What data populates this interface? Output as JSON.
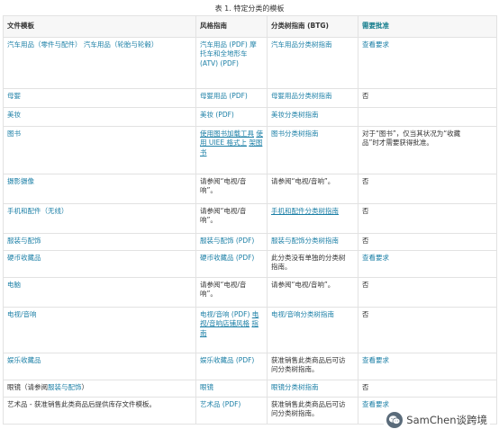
{
  "caption": "表 1. 特定分类的模板",
  "headers": [
    "文件模板",
    "风格指南",
    "分类树指南 (BTG)",
    "需要批准"
  ],
  "rows": [
    {
      "c1": [
        "汽车用品（零件与配件）",
        "汽车用品（轮胎与轮毂）"
      ],
      "c2": [
        "汽车用品 (PDF)",
        "摩托车和全地形车",
        "(ATV) (PDF)"
      ],
      "c3": [
        "汽车用品分类树指南"
      ],
      "c4": [
        "查看要求"
      ]
    },
    {
      "c1": [
        "母婴"
      ],
      "c2": [
        "母婴用品 (PDF)"
      ],
      "c3": [
        "母婴用品分类树指南"
      ],
      "c4": [
        "否"
      ]
    },
    {
      "c1": [
        "美妆"
      ],
      "c2": [
        "美妆 (PDF)"
      ],
      "c3": [
        "美妆分类树指南"
      ],
      "c4": [
        ""
      ]
    },
    {
      "c1": [
        "图书"
      ],
      "c2": [
        "使用图书加载工具",
        "使用 UIEE 格式上",
        "架图书"
      ],
      "c3": [
        "图书分类树指南"
      ],
      "c4": [
        "对于“图书”，仅当其状况为“收藏",
        "品”时才需要获得批准。"
      ]
    },
    {
      "c1": [
        "摄影摄像"
      ],
      "c2": [
        "请参阅“电视/音",
        "响”。"
      ],
      "c3": [
        "请参阅“电视/音响”。"
      ],
      "c4": [
        "否"
      ]
    },
    {
      "c1": [
        "手机和配件（无线）"
      ],
      "c2": [
        "请参阅“电视/音",
        "响”。"
      ],
      "c3": [
        "手机和配件分类树指南"
      ],
      "c4": [
        "否"
      ]
    },
    {
      "c1": [
        "服装与配饰"
      ],
      "c2": [
        "服装与配饰 (PDF)"
      ],
      "c3": [
        "服装与配饰分类树指南"
      ],
      "c4": [
        "否"
      ]
    },
    {
      "c1": [
        "硬币收藏品"
      ],
      "c2": [
        "硬币收藏品 (PDF)"
      ],
      "c3": [
        "此分类没有单独的分类树",
        "指南。"
      ],
      "c4": [
        "查看要求"
      ]
    },
    {
      "c1": [
        "电脑"
      ],
      "c2": [
        "请参阅“电视/音",
        "响”。"
      ],
      "c3": [
        "请参阅“电视/音响”。"
      ],
      "c4": [
        "否"
      ]
    },
    {
      "c1": [
        "电视/音响"
      ],
      "c2": [
        "电视/音响 (PDF)",
        "电视/音响店铺风格",
        "指南"
      ],
      "c3": [
        "电视/音响分类树指南"
      ],
      "c4": [
        "否"
      ]
    },
    {
      "c1": [
        "娱乐收藏品"
      ],
      "c2": [
        "娱乐收藏品 (PDF)"
      ],
      "c3": [
        "获准销售此类商品后可访",
        "问分类树指南。"
      ],
      "c4": [
        "查看要求"
      ]
    },
    {
      "c1": [
        "眼镜（请参阅",
        "服装与配饰",
        "）"
      ],
      "c2": [
        "眼镜"
      ],
      "c3": [
        "眼镜分类树指南"
      ],
      "c4": [
        "否"
      ]
    },
    {
      "c1": [
        "艺术品 - 获准销售此类商品后提供库存文件模板。"
      ],
      "c2": [
        "艺术品 (PDF)"
      ],
      "c3": [
        "获准销售此类商品后可访",
        "问分类树指南。"
      ],
      "c4": [
        "查看要求"
      ]
    }
  ],
  "watermark": {
    "text": "SamChen谈跨境",
    "icon": "wechat-icon"
  },
  "colors": {
    "link": "#1b7fa6",
    "header_accent": "#0f7a8a",
    "text": "#333333",
    "border": "#e2e2e2"
  }
}
